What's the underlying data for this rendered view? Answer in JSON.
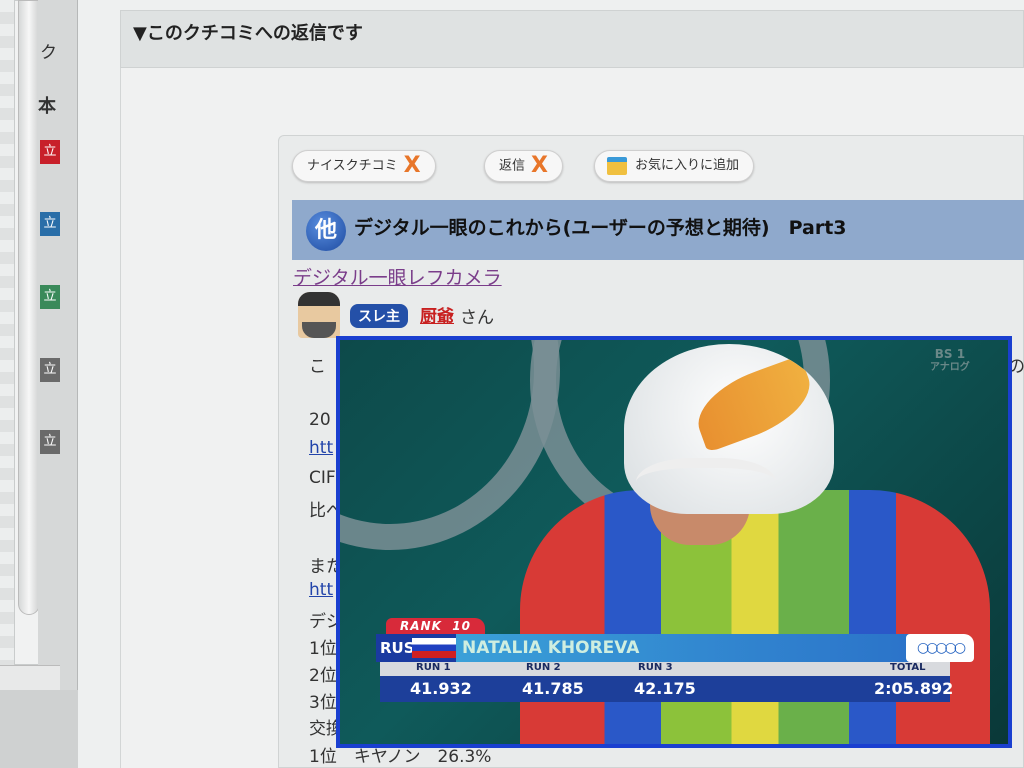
{
  "sidebar": {
    "chars": [
      "ク",
      "本"
    ],
    "tab_glyphs": [
      {
        "glyph": "立",
        "color": "#c8202a"
      },
      {
        "glyph": "立",
        "color": "#2a6ea8"
      },
      {
        "glyph": "立",
        "color": "#3a8a5a"
      },
      {
        "glyph": "立",
        "color": "#6a6a6a"
      },
      {
        "glyph": "立",
        "color": "#6a6a6a"
      }
    ]
  },
  "header": {
    "title": "▼このクチコミへの返信です"
  },
  "toolbar": {
    "nice_label": "ナイスクチコミ",
    "reply_label": "返信",
    "favorite_label": "お気に入りに追加",
    "x_mark": "X"
  },
  "thread": {
    "category_badge": "他",
    "title": "デジタル一眼のこれから(ユーザーの予想と期待)　Part3",
    "category_link": "デジタル一眼レフカメラ",
    "thread_owner_badge": "スレ主",
    "username": "厨爺",
    "honorific": "さん"
  },
  "body_fragments": [
    "こ",
    "20",
    "htt",
    "CIF",
    "比べ",
    "また",
    "htt",
    "デジ",
    "1位",
    "2位",
    "3位",
    "交換",
    "1位　キヤノン　26.3%"
  ],
  "right_fragment": "の",
  "video": {
    "channel": "BS 1",
    "channel_sub": "アナログ",
    "rank_label": "RANK",
    "rank": "10",
    "country": "RUS",
    "athlete": "NATALIA KHOREVA",
    "columns": [
      "RUN 1",
      "RUN 2",
      "RUN 3",
      "TOTAL"
    ],
    "values": [
      "41.932",
      "41.785",
      "42.175",
      "2:05.892"
    ],
    "rings": "○○○○○"
  },
  "colors": {
    "accent_link": "#7a3d8a",
    "title_bar": "#8fa9cc",
    "video_border": "#1a3fd0",
    "x_mark": "#e8762a"
  }
}
